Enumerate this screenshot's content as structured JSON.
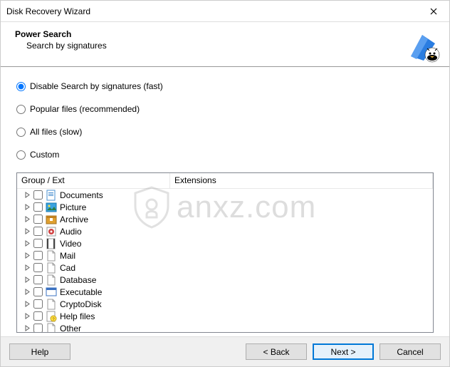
{
  "window": {
    "title": "Disk Recovery Wizard"
  },
  "header": {
    "title": "Power Search",
    "subtitle": "Search by signatures"
  },
  "options": {
    "disable": "Disable Search by signatures (fast)",
    "popular": "Popular files (recommended)",
    "all": "All files (slow)",
    "custom": "Custom"
  },
  "tree": {
    "col1": "Group / Ext",
    "col2": "Extensions",
    "items": [
      {
        "label": "Documents",
        "icon": "doc"
      },
      {
        "label": "Picture",
        "icon": "pic"
      },
      {
        "label": "Archive",
        "icon": "arc"
      },
      {
        "label": "Audio",
        "icon": "aud"
      },
      {
        "label": "Video",
        "icon": "vid"
      },
      {
        "label": "Mail",
        "icon": "file"
      },
      {
        "label": "Cad",
        "icon": "file"
      },
      {
        "label": "Database",
        "icon": "file"
      },
      {
        "label": "Executable",
        "icon": "exe"
      },
      {
        "label": "CryptoDisk",
        "icon": "file"
      },
      {
        "label": "Help files",
        "icon": "help"
      },
      {
        "label": "Other",
        "icon": "file"
      }
    ]
  },
  "footer": {
    "help": "Help",
    "back": "< Back",
    "next": "Next >",
    "cancel": "Cancel"
  },
  "watermark": "anxz.com"
}
